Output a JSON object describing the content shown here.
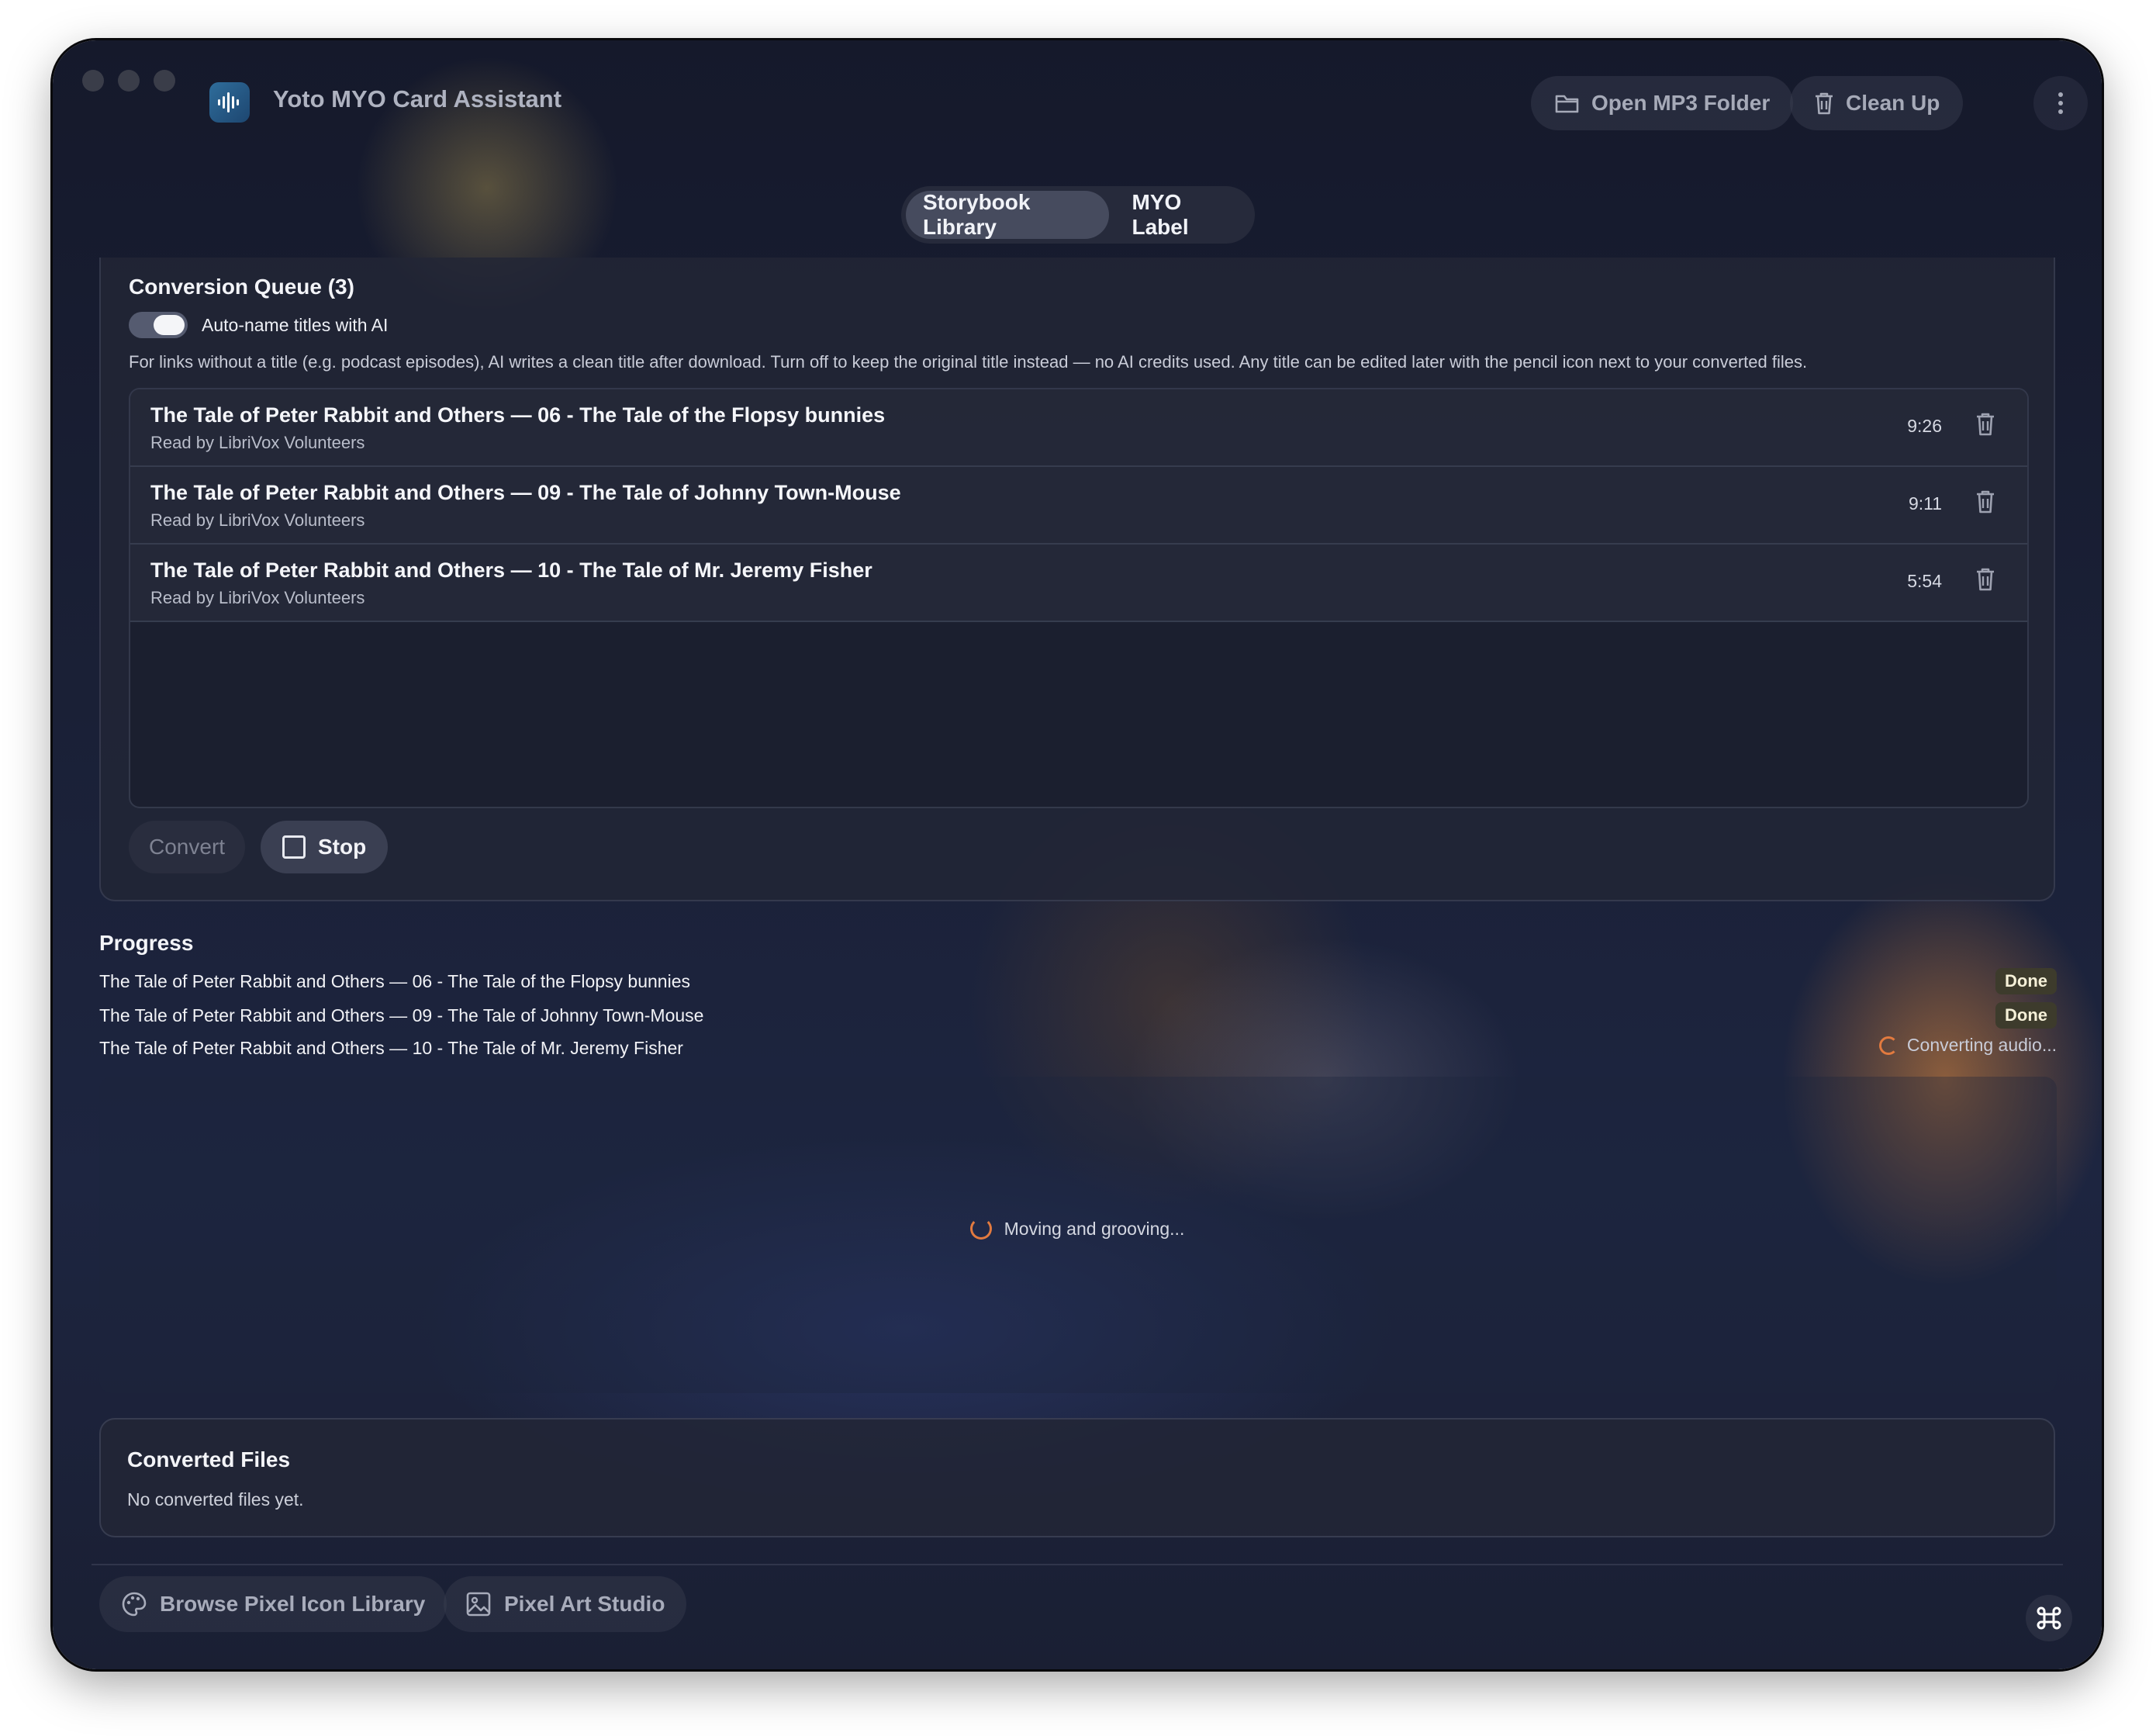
{
  "window": {
    "app_title": "Yoto MYO Card Assistant"
  },
  "toolbar": {
    "open_folder_label": "Open MP3 Folder",
    "clean_up_label": "Clean Up"
  },
  "tabs": [
    {
      "label": "Storybook Library",
      "active": true
    },
    {
      "label": "MYO Label",
      "active": false
    }
  ],
  "queue": {
    "title": "Conversion Queue (3)",
    "auto_name_label": "Auto-name titles with AI",
    "auto_name_enabled": true,
    "help_text": "For links without a title (e.g. podcast episodes), AI writes a clean title after download. Turn off to keep the original title instead — no AI credits used. Any title can be edited later with the pencil icon next to your converted files.",
    "items": [
      {
        "title": "The Tale of Peter Rabbit and Others — 06 - The Tale of the Flopsy bunnies",
        "subtitle": "Read by LibriVox Volunteers",
        "duration": "9:26"
      },
      {
        "title": "The Tale of Peter Rabbit and Others — 09 - The Tale of Johnny Town-Mouse",
        "subtitle": "Read by LibriVox Volunteers",
        "duration": "9:11"
      },
      {
        "title": "The Tale of Peter Rabbit and Others — 10 - The Tale of Mr. Jeremy Fisher",
        "subtitle": "Read by LibriVox Volunteers",
        "duration": "5:54"
      }
    ],
    "convert_label": "Convert",
    "stop_label": "Stop"
  },
  "progress": {
    "title": "Progress",
    "items": [
      {
        "title": "The Tale of Peter Rabbit and Others — 06 - The Tale of the Flopsy bunnies",
        "status": "Done"
      },
      {
        "title": "The Tale of Peter Rabbit and Others — 09 - The Tale of Johnny Town-Mouse",
        "status": "Done"
      },
      {
        "title": "The Tale of Peter Rabbit and Others — 10 - The Tale of Mr. Jeremy Fisher",
        "status": "Converting audio..."
      }
    ],
    "loading_text": "Moving and grooving..."
  },
  "converted": {
    "title": "Converted Files",
    "empty_text": "No converted files yet."
  },
  "footer": {
    "browse_label": "Browse Pixel Icon Library",
    "studio_label": "Pixel Art Studio"
  },
  "colors": {
    "accent_spinner": "#e27a3f",
    "done_badge_bg": "#3d3b2c"
  }
}
